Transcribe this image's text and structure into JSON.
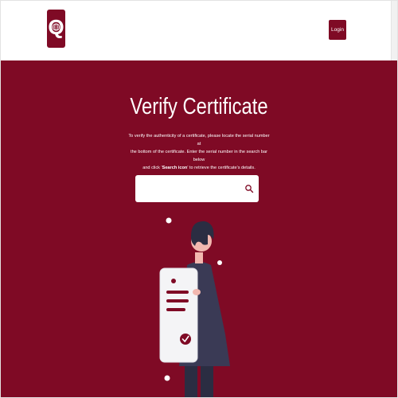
{
  "header": {
    "logo": {
      "icon": "q-globe-logo",
      "letter": "Q"
    },
    "login_label": "Login"
  },
  "hero": {
    "title": "Verify Certificate",
    "description": {
      "line1": "To verify the authenticity of a certificate, please locate the serial number at",
      "line2": "the bottom of the certificate. Enter the serial number in the search bar below",
      "line3_before": "and click '",
      "line3_bold": "Search icon",
      "line3_after": "' to retrieve the certificate's details."
    },
    "search": {
      "value": "",
      "placeholder": "",
      "icon": "search-icon"
    },
    "illustration": {
      "icon": "person-holding-certificate-illustration"
    }
  },
  "colors": {
    "brand": "#7f0a25",
    "header_bg": "#ffffff",
    "text_on_brand": "#ffffff"
  }
}
